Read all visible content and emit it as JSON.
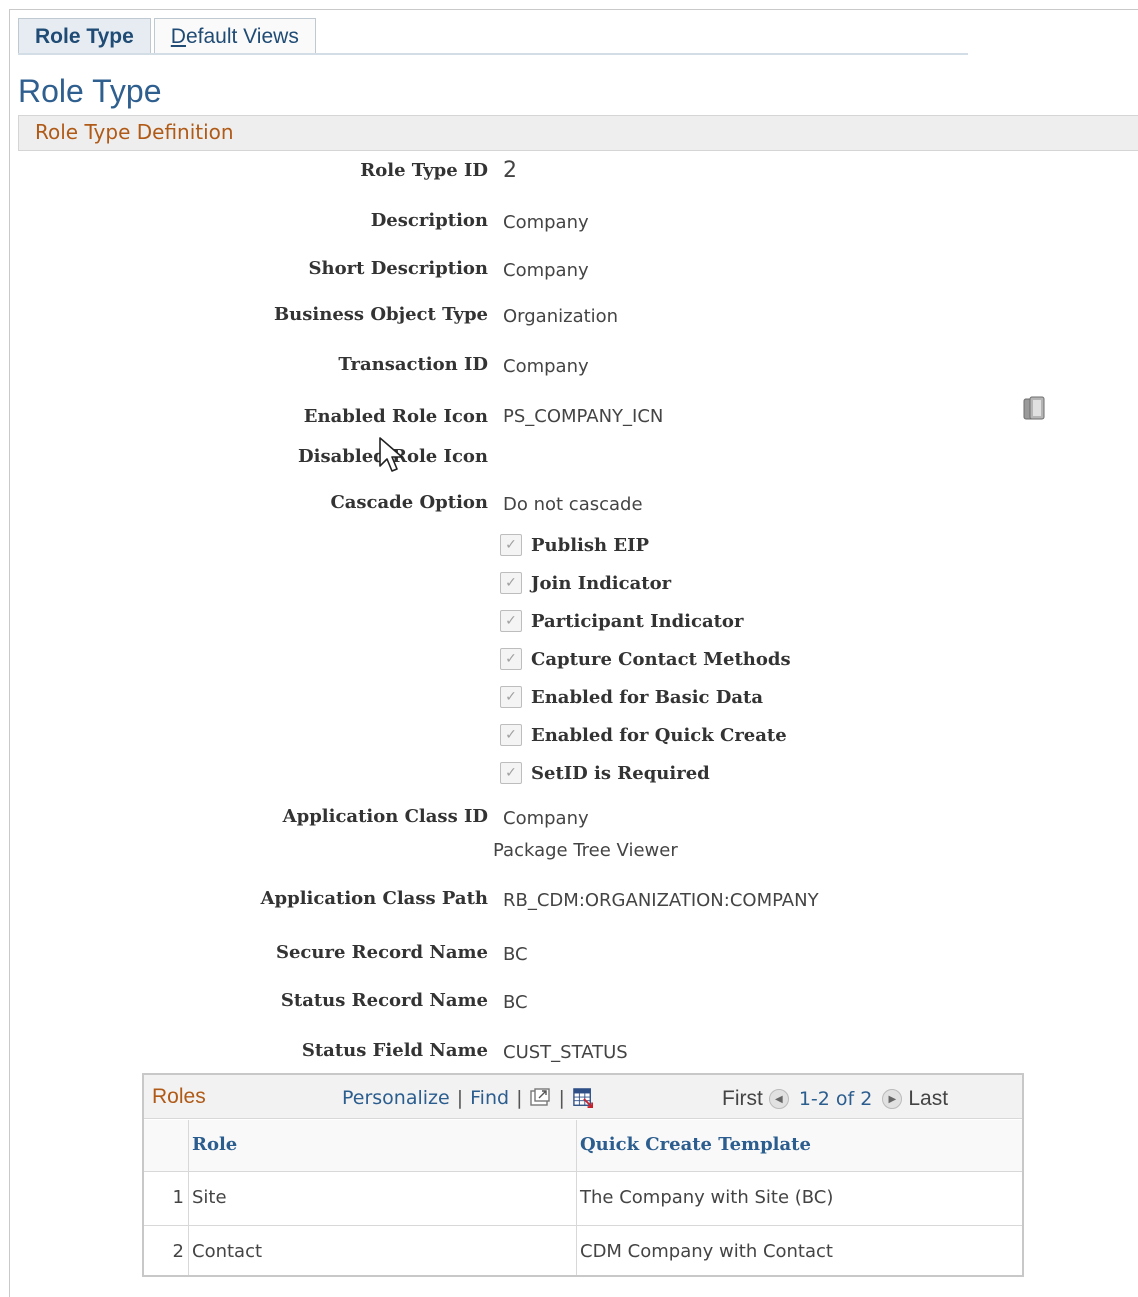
{
  "tabs": [
    {
      "label": "Role Type",
      "active": true
    },
    {
      "label_accel": "D",
      "label_rest": "efault Views",
      "active": false
    }
  ],
  "page_title": "Role Type",
  "section_title": "Role Type Definition",
  "fields": {
    "role_type_id": {
      "label": "Role Type ID",
      "value": "2"
    },
    "description": {
      "label": "Description",
      "value": "Company"
    },
    "short_description": {
      "label": "Short Description",
      "value": "Company"
    },
    "business_object_type": {
      "label": "Business Object Type",
      "value": "Organization"
    },
    "transaction_id": {
      "label": "Transaction ID",
      "value": "Company"
    },
    "enabled_role_icon": {
      "label": "Enabled Role Icon",
      "value": "PS_COMPANY_ICN"
    },
    "disabled_role_icon": {
      "label": "Disabled Role Icon",
      "value": ""
    },
    "cascade_option": {
      "label": "Cascade Option",
      "value": "Do not cascade"
    },
    "application_class_id": {
      "label": "Application Class ID",
      "value": "Company",
      "sub_value": "Package Tree Viewer"
    },
    "application_class_path": {
      "label": "Application Class Path",
      "value": "RB_CDM:ORGANIZATION:COMPANY"
    },
    "secure_record_name": {
      "label": "Secure Record Name",
      "value": "BC"
    },
    "status_record_name": {
      "label": "Status Record Name",
      "value": "BC"
    },
    "status_field_name": {
      "label": "Status Field Name",
      "value": "CUST_STATUS"
    }
  },
  "checkboxes": [
    {
      "label": "Publish EIP",
      "checked": true,
      "disabled": true
    },
    {
      "label": "Join Indicator",
      "checked": true,
      "disabled": true
    },
    {
      "label": "Participant Indicator",
      "checked": true,
      "disabled": true
    },
    {
      "label": "Capture Contact Methods",
      "checked": true,
      "disabled": true
    },
    {
      "label": "Enabled for Basic Data",
      "checked": true,
      "disabled": true
    },
    {
      "label": "Enabled for Quick Create",
      "checked": true,
      "disabled": true
    },
    {
      "label": "SetID is Required",
      "checked": true,
      "disabled": true
    }
  ],
  "checkmark": "✓",
  "icons": {
    "role_icon_lookup": "documents-icon",
    "zoom": "zoom-icon",
    "download": "download-spreadsheet-icon",
    "nav_prev": "previous-arrow-icon",
    "nav_next": "next-arrow-icon"
  },
  "roles_grid": {
    "title": "Roles",
    "personalize": "Personalize",
    "separator": "|",
    "find": "Find",
    "first": "First",
    "range": "1-2 of 2",
    "last": "Last",
    "columns": [
      "Role",
      "Quick Create Template"
    ],
    "rows": [
      {
        "num": "1",
        "role": "Site",
        "template": "The Company with Site (BC)"
      },
      {
        "num": "2",
        "role": "Contact",
        "template": "CDM Company with Contact"
      }
    ]
  },
  "colors": {
    "section_header_text": "#b05a17",
    "link": "#2b5d8e",
    "page_title": "#2f5f8f"
  }
}
